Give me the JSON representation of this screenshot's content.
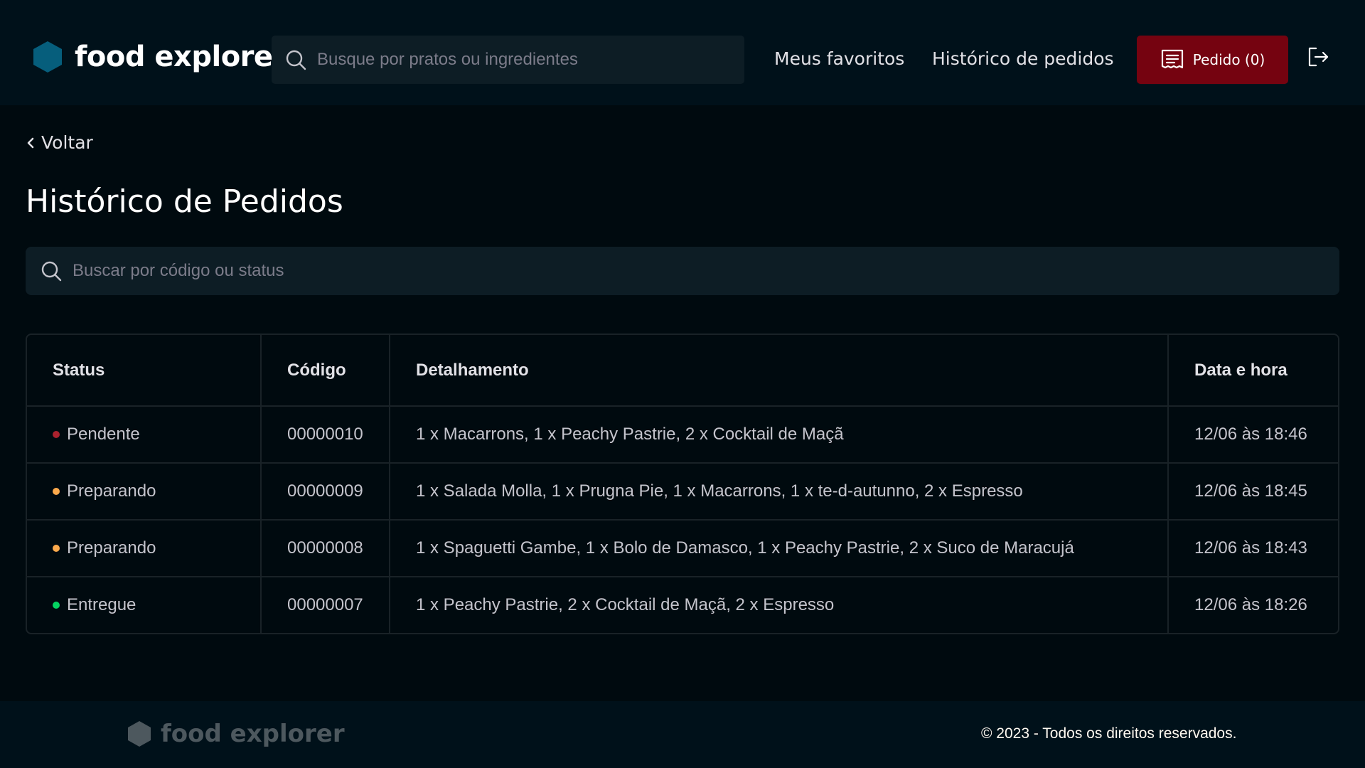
{
  "header": {
    "brand": "food explorer",
    "search_placeholder": "Busque por pratos ou ingredientes",
    "nav": {
      "favorites": "Meus favoritos",
      "history": "Histórico de pedidos"
    },
    "order_button": "Pedido (0)"
  },
  "main": {
    "back_label": "Voltar",
    "title": "Histórico de Pedidos",
    "search_placeholder": "Buscar por código ou status",
    "table": {
      "columns": [
        "Status",
        "Código",
        "Detalhamento",
        "Data e hora"
      ],
      "rows": [
        {
          "status": "Pendente",
          "status_color": "#AB222E",
          "code": "00000010",
          "detail": "1 x Macarrons, 1 x Peachy Pastrie, 2 x Cocktail de Maçã",
          "datetime": "12/06 às 18:46"
        },
        {
          "status": "Preparando",
          "status_color": "#FBA94C",
          "code": "00000009",
          "detail": "1 x Salada Molla, 1 x Prugna Pie, 1 x Macarrons, 1 x te-d-autunno, 2 x Espresso",
          "datetime": "12/06 às 18:45"
        },
        {
          "status": "Preparando",
          "status_color": "#FBA94C",
          "code": "00000008",
          "detail": "1 x Spaguetti Gambe, 1 x Bolo de Damasco, 1 x Peachy Pastrie, 2 x Suco de Maracujá",
          "datetime": "12/06 às 18:43"
        },
        {
          "status": "Entregue",
          "status_color": "#04D361",
          "code": "00000007",
          "detail": "1 x Peachy Pastrie, 2 x Cocktail de Maçã, 2 x Espresso",
          "datetime": "12/06 às 18:26"
        }
      ]
    }
  },
  "footer": {
    "brand": "food explorer",
    "copyright": "© 2023 - Todos os direitos reservados."
  },
  "colors": {
    "brand_hex": "#065E7C",
    "accent_red": "#750310",
    "background": "#000A0F",
    "header_bg": "#00111A",
    "input_bg": "#0D1D25"
  },
  "icons": {
    "logo": "hexagon-logo-icon",
    "search": "search-icon",
    "order": "receipt-icon",
    "logout": "sign-out-icon",
    "back": "chevron-left-icon"
  }
}
